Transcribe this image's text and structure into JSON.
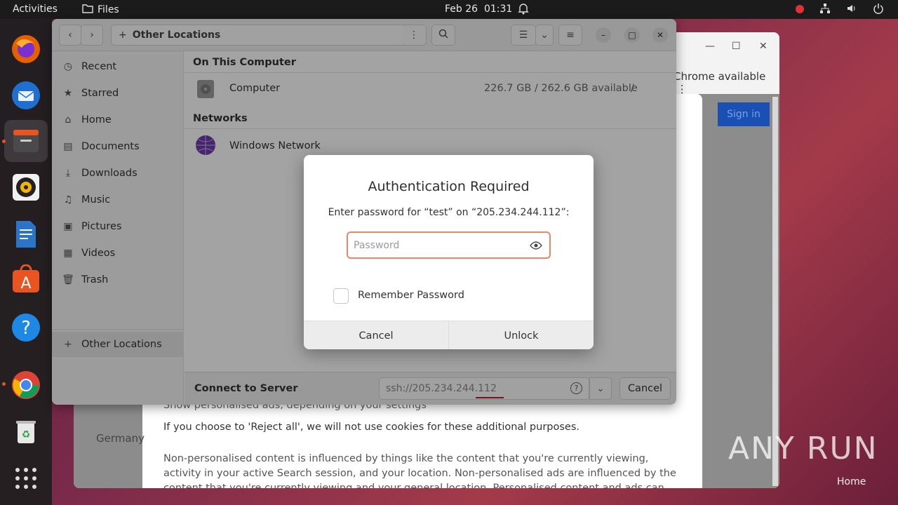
{
  "topbar": {
    "activities": "Activities",
    "app_name": "Files",
    "date": "Feb 26",
    "time": "01:31"
  },
  "dock": {
    "items": [
      "firefox-icon",
      "thunderbird-icon",
      "files-icon",
      "rhythmbox-icon",
      "writer-icon",
      "app-center-icon",
      "help-icon",
      "chrome-icon",
      "trash-icon",
      "apps-grid-icon"
    ]
  },
  "browser": {
    "chrome_available": "Chrome available",
    "sign_in": "Sign in",
    "consent_line1": "Show personalised ads, depending on your settings",
    "consent_line2": "If you choose to 'Reject all', we will not use cookies for these additional purposes.",
    "consent_line3": "Non-personalised content is influenced by things like the content that you're currently viewing, activity in your active Search session, and your location. Non-personalised ads are influenced by the content that you're currently viewing and your general location. Personalised content and ads can also include more relevant results,",
    "country": "Germany"
  },
  "files": {
    "path_label": "Other Locations",
    "sidebar": [
      {
        "icon": "clock-icon",
        "label": "Recent"
      },
      {
        "icon": "star-icon",
        "label": "Starred"
      },
      {
        "icon": "home-icon",
        "label": "Home"
      },
      {
        "icon": "document-icon",
        "label": "Documents"
      },
      {
        "icon": "download-icon",
        "label": "Downloads"
      },
      {
        "icon": "music-icon",
        "label": "Music"
      },
      {
        "icon": "picture-icon",
        "label": "Pictures"
      },
      {
        "icon": "video-icon",
        "label": "Videos"
      },
      {
        "icon": "trash-icon",
        "label": "Trash"
      },
      {
        "icon": "plus-icon",
        "label": "Other Locations"
      }
    ],
    "on_this_computer": "On This Computer",
    "computer_label": "Computer",
    "computer_space": "226.7 GB / 262.6 GB available",
    "computer_path": "/",
    "networks": "Networks",
    "windows_network": "Windows Network",
    "connect_to_server": "Connect to Server",
    "server_address": "ssh://205.234.244.112",
    "cancel": "Cancel"
  },
  "dialog": {
    "title": "Authentication Required",
    "message": "Enter password for “test” on “205.234.244.112”:",
    "password_placeholder": "Password",
    "remember": "Remember Password",
    "cancel": "Cancel",
    "unlock": "Unlock"
  },
  "watermark": {
    "text": "ANY RUN",
    "home": "Home"
  }
}
